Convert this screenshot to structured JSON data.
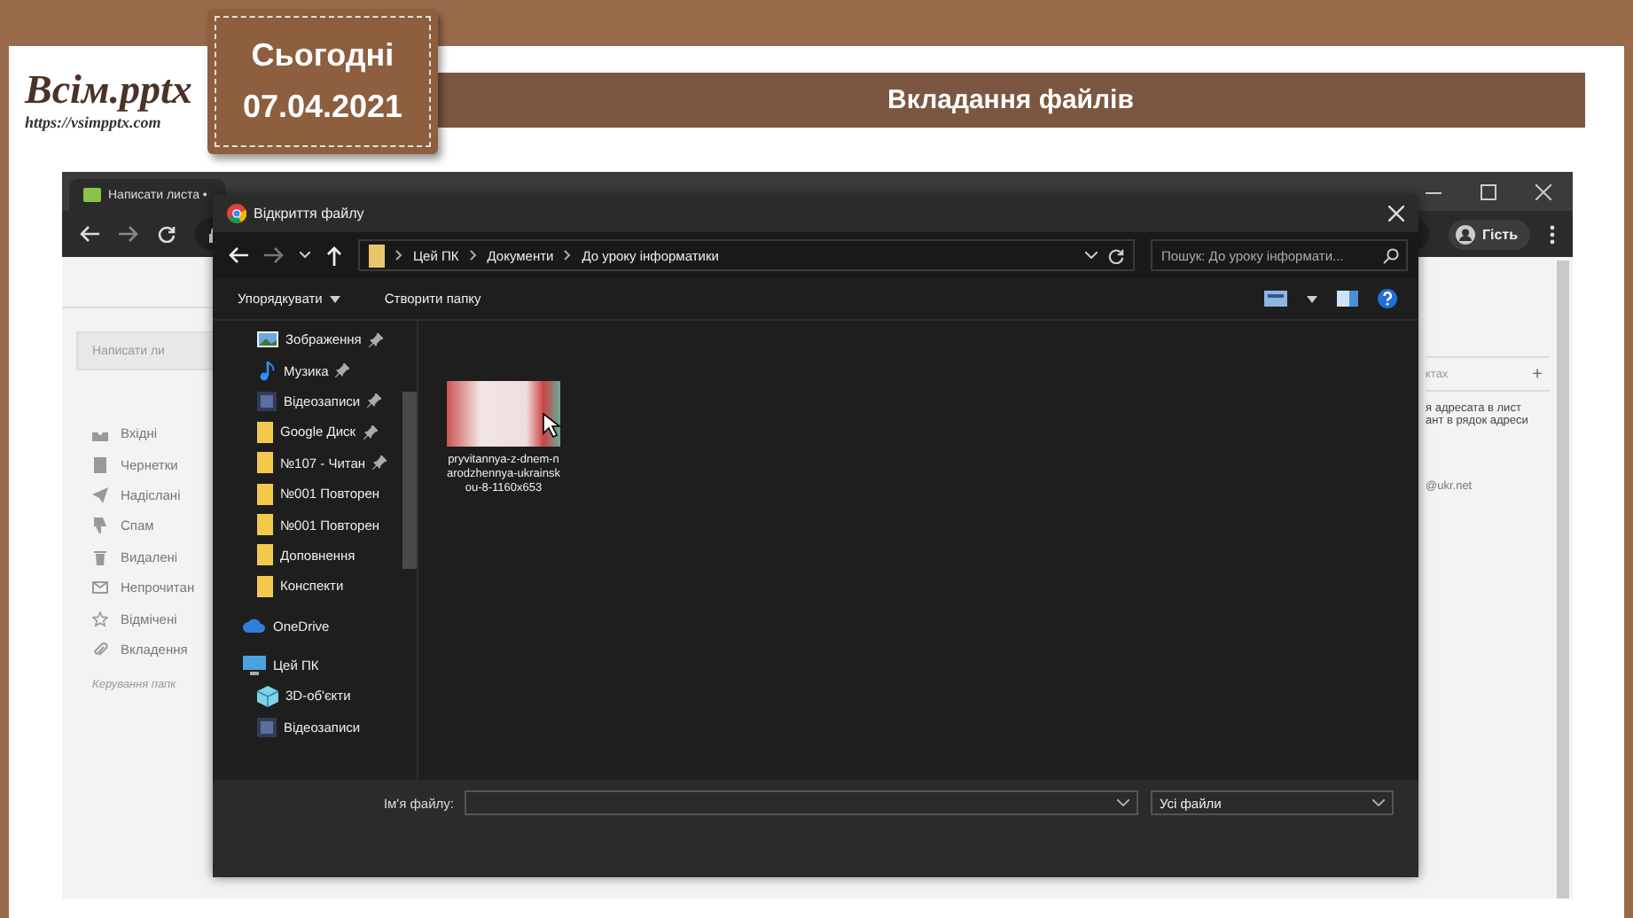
{
  "slide": {
    "logo": {
      "name": "Всім.pptx",
      "url": "https://vsimpptx.com"
    },
    "date_tag": {
      "label": "Сьогодні",
      "date": "07.04.2021"
    },
    "title": "Вкладання файлів"
  },
  "browser": {
    "tab_title": "Написати листа •",
    "profile": "Гість"
  },
  "mail": {
    "compose": "Написати ли",
    "folders": [
      {
        "label": "Вхідні",
        "kind": "inbox"
      },
      {
        "label": "Чернетки",
        "kind": "drafts"
      },
      {
        "label": "Надіслані",
        "kind": "sent"
      },
      {
        "label": "Спам",
        "kind": "spam"
      },
      {
        "label": "Видалені",
        "kind": "trash"
      },
      {
        "label": "Непрочитан",
        "kind": "unread"
      },
      {
        "label": "Відмічені",
        "kind": "starred"
      },
      {
        "label": "Вкладення",
        "kind": "attachments"
      }
    ],
    "manage": "Керування папк",
    "panel": {
      "tab": "ктах",
      "add": "+",
      "hint_lines": [
        "я адресата в лист",
        "ант в рядок адреси"
      ],
      "email": "@ukr.net"
    }
  },
  "dialog": {
    "title": "Відкриття файлу",
    "breadcrumb": [
      "Цей ПК",
      "Документи",
      "До уроку інформатики"
    ],
    "search": {
      "placeholder": "Пошук: До уроку інформати..."
    },
    "toolbar": [
      "Упорядкувати",
      "Створити папку"
    ],
    "quick_access": [
      {
        "label": "Зображення",
        "kind": "pictures",
        "pinned": true
      },
      {
        "label": "Музика",
        "kind": "music",
        "pinned": true
      },
      {
        "label": "Відеозаписи",
        "kind": "videos",
        "pinned": true
      },
      {
        "label": "Google Диск",
        "kind": "folder",
        "pinned": true
      },
      {
        "label": "№107 - Читан",
        "kind": "folder",
        "pinned": true
      },
      {
        "label": "№001 Повторен",
        "kind": "folder",
        "pinned": false
      },
      {
        "label": "№001 Повторен",
        "kind": "folder",
        "pinned": false
      },
      {
        "label": "Доповнення",
        "kind": "folder",
        "pinned": false
      },
      {
        "label": "Конспекти",
        "kind": "folder",
        "pinned": false
      }
    ],
    "locations": [
      {
        "label": "OneDrive",
        "kind": "onedrive"
      },
      {
        "label": "Цей ПК",
        "kind": "pc",
        "children": [
          {
            "label": "3D-об'єкти",
            "kind": "objects3d"
          },
          {
            "label": "Відеозаписи",
            "kind": "videos"
          }
        ]
      }
    ],
    "files": [
      {
        "name": "pryvitannya-z-dnem-narodzhennya-ukrainskou-8-1160x653"
      }
    ],
    "filename_label": "Ім'я файлу:",
    "filetype": "Усі файли"
  }
}
